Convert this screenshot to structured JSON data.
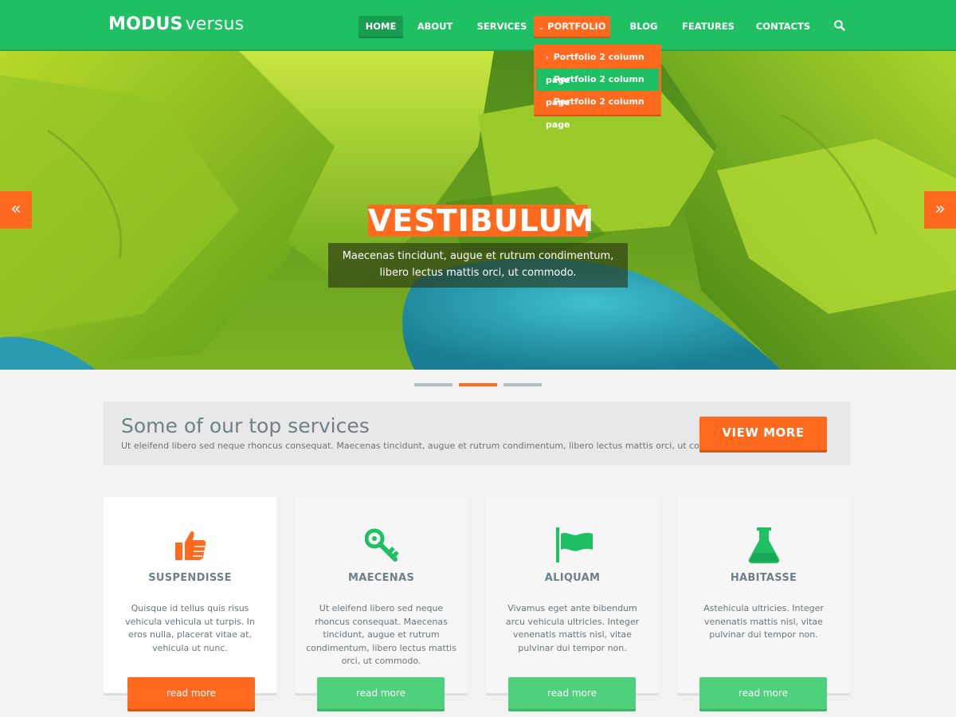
{
  "header": {
    "logo_bold": "MODUS",
    "logo_light": "versus",
    "nav": [
      {
        "label": "HOME"
      },
      {
        "label": "ABOUT"
      },
      {
        "label": "SERVICES"
      },
      {
        "label": "PORTFOLIO"
      },
      {
        "label": "BLOG"
      },
      {
        "label": "FEATURES"
      },
      {
        "label": "CONTACTS"
      }
    ],
    "active_item": "HOME",
    "open_menu": "PORTFOLIO",
    "search_icon": "search-icon"
  },
  "dropdown": {
    "items": [
      {
        "label": "Portfolio 2 column page"
      },
      {
        "label": "Portfolio 2 column page"
      },
      {
        "label": "Portfolio 2 column page"
      }
    ],
    "highlighted_index": 1
  },
  "hero": {
    "title": "VESTIBULUM",
    "caption_line1": "Maecenas tincidunt, augue et rutrum condimentum,",
    "caption_line2": "libero lectus mattis orci, ut commodo.",
    "prev_icon": "double-chevron-left-icon",
    "next_icon": "double-chevron-right-icon",
    "slides_count": 3,
    "active_slide": 2
  },
  "services": {
    "title": "Some of our top services",
    "subtitle": "Ut eleifend libero sed neque rhoncus consequat. Maecenas tincidunt, augue et rutrum condimentum, libero lectus mattis orci, ut commodo.",
    "button": "VIEW MORE"
  },
  "cards": [
    {
      "title": "SUSPENDISSE",
      "text": "Quisque id tellus quis risus vehicula vehicula ut turpis. In eros nulla, placerat vitae at, vehicula ut nunc.",
      "button": "read more",
      "icon": "thumbs-up-icon"
    },
    {
      "title": "MAECENAS",
      "text": "Ut eleifend libero sed neque rhoncus consequat. Maecenas tincidunt, augue et rutrum condimentum, libero lectus mattis orci, ut commodo.",
      "button": "read more",
      "icon": "key-icon"
    },
    {
      "title": "ALIQUAM",
      "text": "Vivamus eget ante bibendum arcu vehicula ultricies. Integer venenatis mattis nisl, vitae pulvinar dui tempor non.",
      "button": "read more",
      "icon": "flag-icon"
    },
    {
      "title": "HABITASSE",
      "text": "Astehicula ultricies. Integer venenatis mattis nisl, vitae pulvinar dui tempor non.",
      "button": "read more",
      "icon": "flask-icon"
    }
  ],
  "colors": {
    "brand_green": "#1fbf63",
    "accent_orange": "#ff6a1f",
    "button_green": "#4fd17c",
    "heading_gray": "#6d8189"
  }
}
